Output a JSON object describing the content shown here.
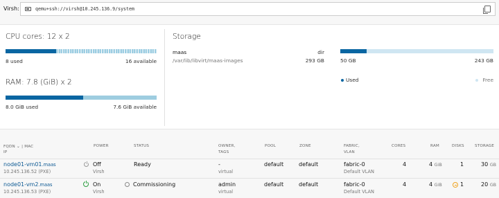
{
  "virsh": {
    "label": "Virsh:",
    "address": "qemu+ssh://virsh@10.245.136.9/system"
  },
  "cpu": {
    "title": "CPU cores: 12 x 2",
    "used_label": "8 used",
    "available_label": "16 available",
    "used": 8,
    "total": 24
  },
  "ram": {
    "title": "RAM: 7.8 (GiB) x 2",
    "used_label": "8.0 GiB used",
    "available_label": "7.6 GiB available",
    "used_gib": 8.0,
    "total_gib": 15.6
  },
  "storage": {
    "title": "Storage",
    "pool_name": "maas",
    "pool_type": "dir",
    "pool_path": "/var/lib/libvirt/maas-images",
    "pool_size": "293 GB",
    "used_label": "50 GB",
    "free_label": "243 GB",
    "used_gb": 50,
    "total_gb": 293,
    "legend_used": "Used",
    "legend_free": "Free"
  },
  "table": {
    "headers": {
      "fqdn": "FQDN",
      "mac": "MAC",
      "ip": "IP",
      "power": "POWER",
      "status": "STATUS",
      "owner": "OWNER,",
      "tags": "TAGS",
      "pool": "POOL",
      "zone": "ZONE",
      "fabric": "FABRIC,",
      "vlan": "VLAN",
      "cores": "CORES",
      "ram": "RAM",
      "disks": "DISKS",
      "storage": "STORAGE"
    },
    "rows": [
      {
        "fqdn_host": "node01-vm01",
        "fqdn_domain": ".maas",
        "ip": "10.245.136.52 (PXE)",
        "power": "Off",
        "power_type": "Virsh",
        "status": "Ready",
        "owner": "-",
        "tags": "virtual",
        "pool": "default",
        "zone": "default",
        "fabric": "fabric-0",
        "vlan": "Default VLAN",
        "cores": "4",
        "ram_value": "4",
        "ram_unit": "GiB",
        "disks": "1",
        "storage_value": "30",
        "storage_unit": "GB"
      },
      {
        "fqdn_host": "node01-vm2",
        "fqdn_domain": ".maas",
        "ip": "10.245.136.53 (PXE)",
        "power": "On",
        "power_type": "Virsh",
        "status": "Commissioning",
        "owner": "admin",
        "tags": "virtual",
        "pool": "default",
        "zone": "default",
        "fabric": "fabric-0",
        "vlan": "Default VLAN",
        "cores": "4",
        "ram_value": "4",
        "ram_unit": "GiB",
        "disks": "1",
        "storage_value": "20",
        "storage_unit": "GB"
      }
    ]
  },
  "icons": {
    "terminal": "terminal-icon",
    "copy": "copy-icon",
    "power_off": "power-off-icon",
    "power_on": "power-on-icon",
    "status_pending": "status-pending-icon",
    "warning": "warning-icon",
    "chevron": "chevron-down-icon"
  },
  "colors": {
    "used": "#0a66a2",
    "free": "#9ecde0",
    "link": "#0e5a94",
    "power_on": "#2a9e3f",
    "warning": "#f0a420"
  }
}
